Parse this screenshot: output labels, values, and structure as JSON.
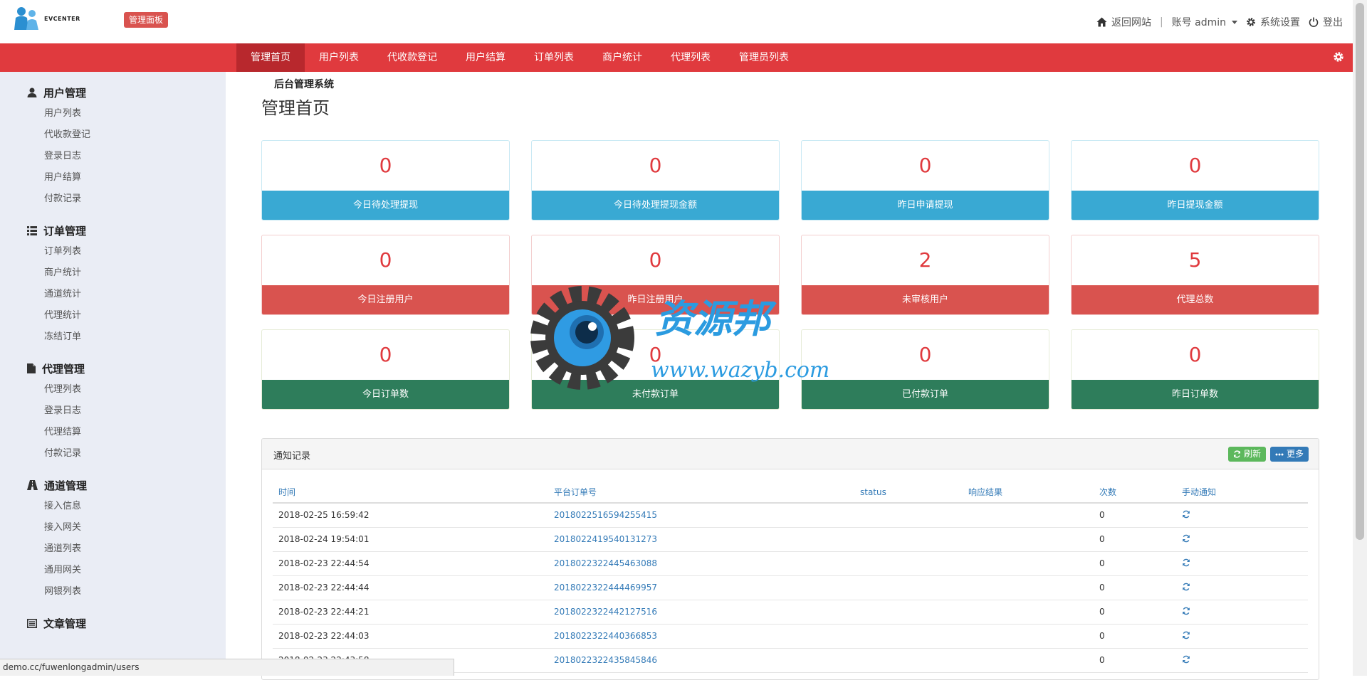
{
  "header": {
    "logo_sub": "EVCENTER",
    "logo_main": "后台管理系统",
    "panel_badge": "管理面板",
    "back_site": "返回网站",
    "separator": "|",
    "account": "账号 admin",
    "settings": "系统设置",
    "logout": "登出"
  },
  "nav": {
    "tabs": [
      "管理首页",
      "用户列表",
      "代收款登记",
      "用户结算",
      "订单列表",
      "商户统计",
      "代理列表",
      "管理员列表"
    ]
  },
  "sidebar": {
    "groups": [
      {
        "title": "用户管理",
        "items": [
          "用户列表",
          "代收款登记",
          "登录日志",
          "用户结算",
          "付款记录"
        ]
      },
      {
        "title": "订单管理",
        "items": [
          "订单列表",
          "商户统计",
          "通道统计",
          "代理统计",
          "冻结订单"
        ]
      },
      {
        "title": "代理管理",
        "items": [
          "代理列表",
          "登录日志",
          "代理结算",
          "付款记录"
        ]
      },
      {
        "title": "通道管理",
        "items": [
          "接入信息",
          "接入网关",
          "通道列表",
          "通用网关",
          "网银列表"
        ]
      },
      {
        "title": "文章管理",
        "items": []
      }
    ]
  },
  "main": {
    "title": "管理首页",
    "cards": [
      {
        "value": "0",
        "label": "今日待处理提现",
        "color": "blue"
      },
      {
        "value": "0",
        "label": "今日待处理提现金额",
        "color": "blue"
      },
      {
        "value": "0",
        "label": "昨日申请提现",
        "color": "blue"
      },
      {
        "value": "0",
        "label": "昨日提现金额",
        "color": "blue"
      },
      {
        "value": "0",
        "label": "今日注册用户",
        "color": "red"
      },
      {
        "value": "0",
        "label": "昨日注册用户",
        "color": "red"
      },
      {
        "value": "2",
        "label": "未审核用户",
        "color": "red"
      },
      {
        "value": "5",
        "label": "代理总数",
        "color": "red"
      },
      {
        "value": "0",
        "label": "今日订单数",
        "color": "green"
      },
      {
        "value": "0",
        "label": "未付款订单",
        "color": "green"
      },
      {
        "value": "0",
        "label": "已付款订单",
        "color": "green"
      },
      {
        "value": "0",
        "label": "昨日订单数",
        "color": "green"
      }
    ]
  },
  "notice": {
    "title": "通知记录",
    "refresh": "刷新",
    "more": "更多",
    "columns": [
      "时间",
      "平台订单号",
      "status",
      "响应结果",
      "次数",
      "手动通知"
    ],
    "rows": [
      {
        "time": "2018-02-25 16:59:42",
        "order": "2018022516594255415",
        "status": "",
        "result": "",
        "count": "0"
      },
      {
        "time": "2018-02-24 19:54:01",
        "order": "2018022419540131273",
        "status": "",
        "result": "",
        "count": "0"
      },
      {
        "time": "2018-02-23 22:44:54",
        "order": "2018022322445463088",
        "status": "",
        "result": "",
        "count": "0"
      },
      {
        "time": "2018-02-23 22:44:44",
        "order": "2018022322444469957",
        "status": "",
        "result": "",
        "count": "0"
      },
      {
        "time": "2018-02-23 22:44:21",
        "order": "2018022322442127516",
        "status": "",
        "result": "",
        "count": "0"
      },
      {
        "time": "2018-02-23 22:44:03",
        "order": "2018022322440366853",
        "status": "",
        "result": "",
        "count": "0"
      },
      {
        "time": "2018-02-23 22:43:58",
        "order": "2018022322435845846",
        "status": "",
        "result": "",
        "count": "0"
      }
    ]
  },
  "watermark": {
    "name": "资源邦",
    "url": "www.wazyb.com"
  },
  "statusbar": {
    "url": "demo.cc/fuwenlongadmin/users"
  },
  "colors": {
    "accent": "#e03a3e",
    "blue": "#39a9d3",
    "red": "#d9534f",
    "green": "#2e7d5b",
    "link": "#337ab7"
  }
}
